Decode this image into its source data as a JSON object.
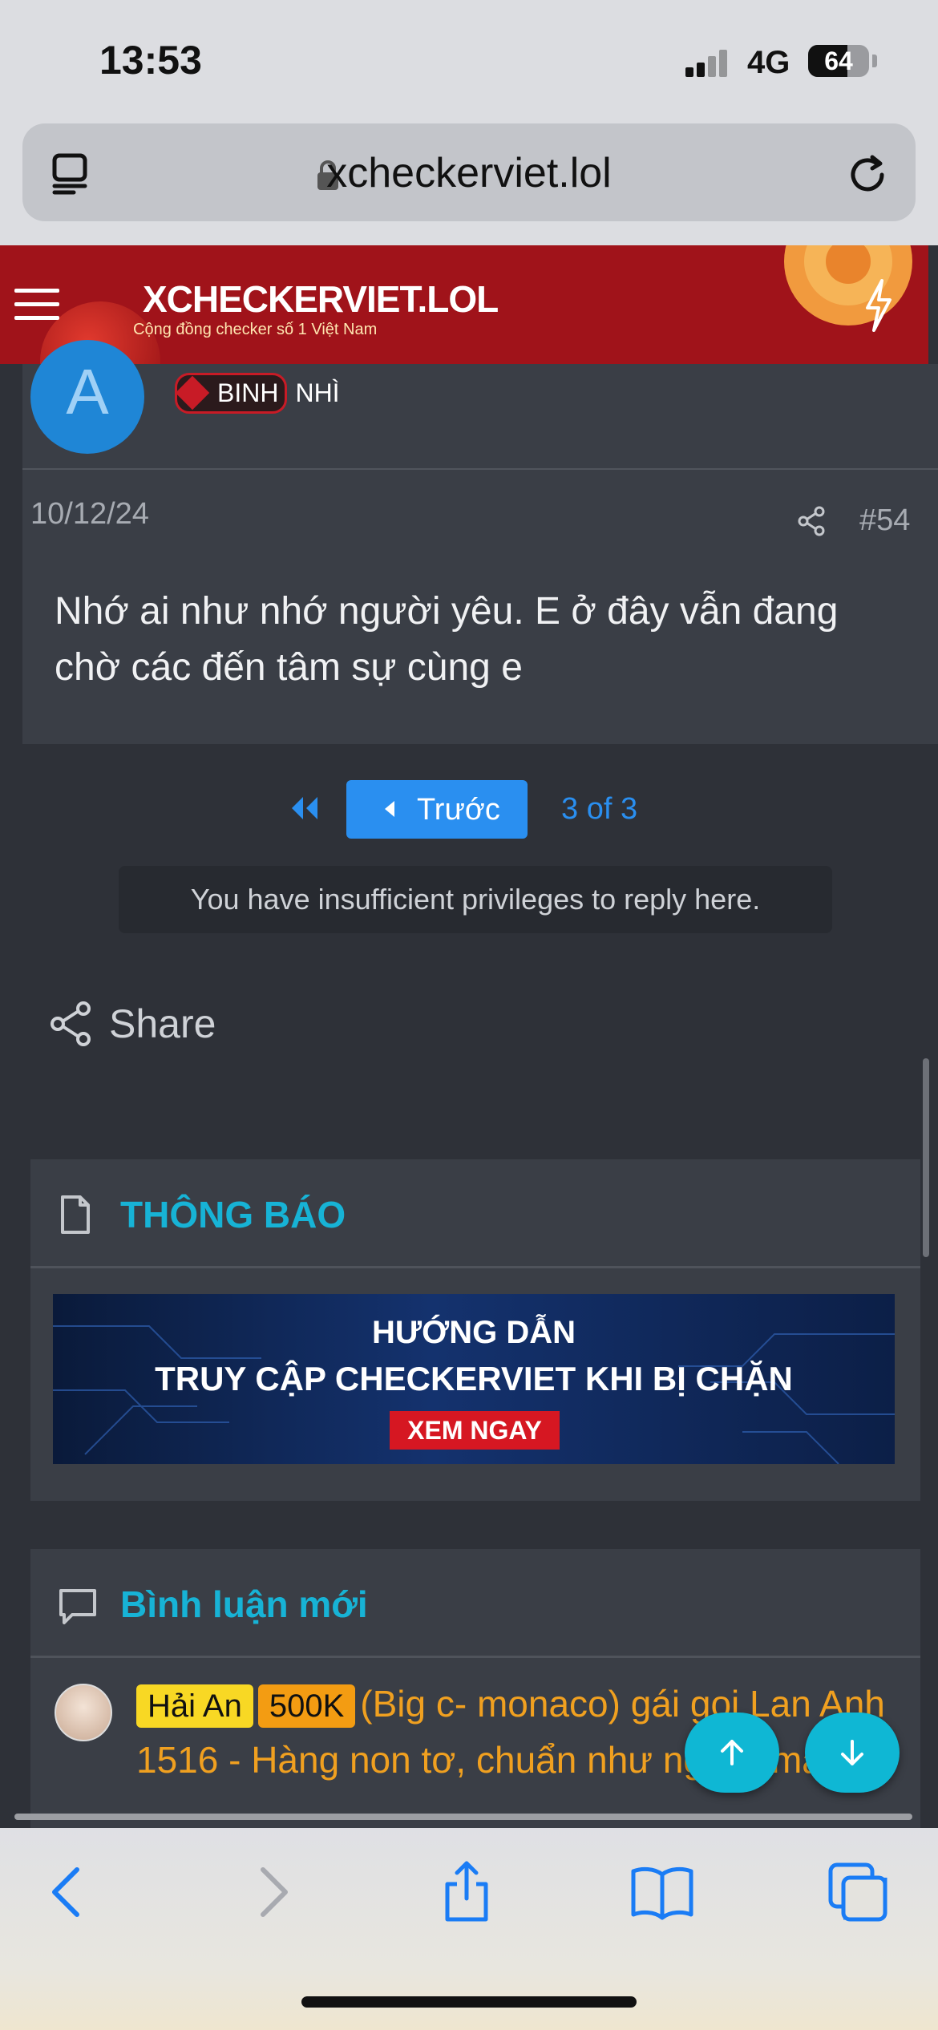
{
  "status_bar": {
    "time": "13:53",
    "network": "4G",
    "battery": "64",
    "battery_fraction": 0.64
  },
  "browser": {
    "domain": "xcheckerviet.lol"
  },
  "site": {
    "logo": "XCHECKERVIET.LOL",
    "tagline": "Cộng đồng checker số 1 Việt Nam"
  },
  "post": {
    "avatar_letter": "A",
    "rank_badge": "BINH",
    "rank_rest": "NHÌ",
    "date": "10/12/24",
    "number": "#54",
    "body": "Nhớ ai như nhớ người yêu. E ở đây vẫn đang chờ các đến tâm sự cùng e"
  },
  "pagination": {
    "prev_label": "Trước",
    "pages": "3 of 3"
  },
  "notice": "You have insufficient privileges to reply here.",
  "share_label": "Share",
  "widgets": {
    "announcements": {
      "title": "THÔNG BÁO",
      "banner_line1": "HƯỚNG DẪN",
      "banner_line2": "TRUY CẬP CHECKERVIET KHI BỊ CHẶN",
      "banner_cta": "XEM NGAY"
    },
    "new_comments": {
      "title": "Bình luận mới",
      "item": {
        "tag1": "Hải An",
        "tag2": "500K",
        "text": "(Big c- monaco) gái gọi Lan Anh 1516 - Hàng non tơ, chuẩn như người mẫu."
      }
    }
  },
  "colors": {
    "accent": "#17b3d6",
    "link": "#2a8ff0",
    "header": "#a0131a",
    "comment_text": "#f0a020"
  },
  "icons": [
    "reader-icon",
    "lock-icon",
    "reload-icon",
    "hamburger-icon",
    "bolt-icon",
    "share-icon",
    "first-page-icon",
    "document-icon",
    "chat-icon",
    "arrow-up-icon",
    "arrow-down-icon",
    "back-icon",
    "forward-icon",
    "share-sheet-icon",
    "bookmarks-icon",
    "tabs-icon"
  ]
}
